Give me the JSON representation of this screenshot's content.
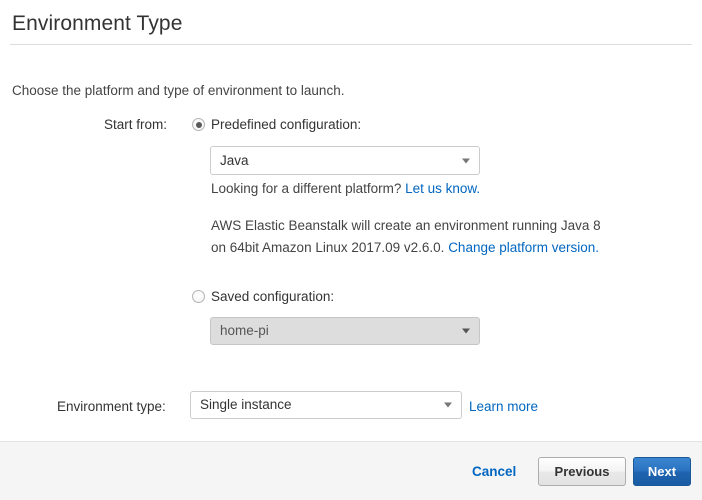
{
  "header": {
    "title": "Environment Type"
  },
  "intro": {
    "text": "Choose the platform and type of environment to launch."
  },
  "form": {
    "start_from": {
      "label": "Start from:",
      "options": [
        {
          "id": "predefined",
          "label": "Predefined configuration:",
          "selected": true,
          "select_value": "Java",
          "select_enabled": true
        },
        {
          "id": "saved",
          "label": "Saved configuration:",
          "selected": false,
          "select_value": "home-pi",
          "select_enabled": false
        }
      ]
    },
    "helper": {
      "question": "Looking for a different platform? ",
      "link_label": "Let us know."
    },
    "info": {
      "text_before": "AWS Elastic Beanstalk will create an environment running Java 8 on 64bit Amazon Linux 2017.09 v2.6.0. ",
      "link_label": "Change platform version."
    },
    "environment_type": {
      "label": "Environment type:",
      "value": "Single instance",
      "learn_more_label": "Learn more"
    }
  },
  "footer": {
    "cancel_label": "Cancel",
    "previous_label": "Previous",
    "next_label": "Next"
  },
  "colors": {
    "link": "#0066c0",
    "primary_button": "#2c74c2",
    "footer_background": "#f5f5f5",
    "text": "#333333"
  }
}
